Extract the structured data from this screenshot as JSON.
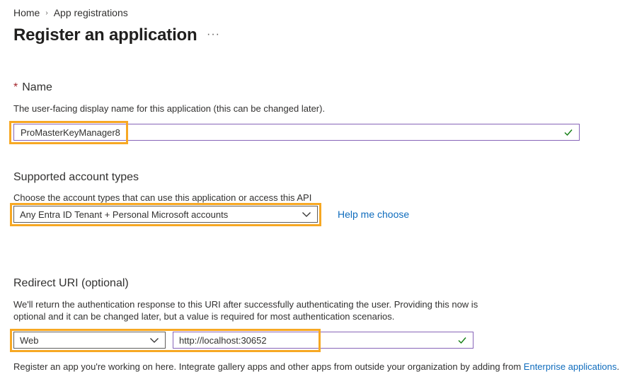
{
  "breadcrumb": {
    "home": "Home",
    "current": "App registrations"
  },
  "page": {
    "title": "Register an application",
    "more": "···"
  },
  "name_section": {
    "required_mark": "*",
    "title": "Name",
    "description": "The user-facing display name for this application (this can be changed later).",
    "value": "ProMasterKeyManager8"
  },
  "account_section": {
    "title": "Supported account types",
    "description": "Choose the account types that can use this application or access this API",
    "selected": "Any Entra ID Tenant + Personal Microsoft accounts",
    "help_link": "Help me choose"
  },
  "redirect_section": {
    "title": "Redirect URI (optional)",
    "description_line1": "We'll return the authentication response to this URI after successfully authenticating the user. Providing this now is",
    "description_line2": "optional and it can be changed later, but a value is required for most authentication scenarios.",
    "platform": "Web",
    "uri": "http://localhost:30652"
  },
  "footer": {
    "text": "Register an app you're working on here. Integrate gallery apps and other apps from outside your organization by adding from ",
    "link": "Enterprise applications",
    "end": "."
  },
  "colors": {
    "highlight": "#f7a823",
    "link": "#0f6cbd",
    "valid_check": "#107c10",
    "input_border": "#8764b8"
  },
  "icons": {
    "check": "check-icon",
    "chevron": "chevron-down-icon",
    "breadcrumb_sep": "chevron-right-icon"
  }
}
